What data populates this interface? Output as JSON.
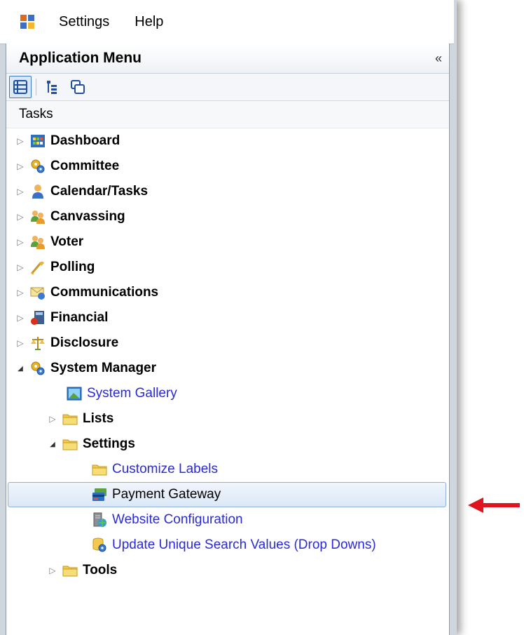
{
  "menubar": {
    "items": [
      "Settings",
      "Help"
    ]
  },
  "panel": {
    "title": "Application Menu",
    "collapse_glyph": "«",
    "section_label": "Tasks"
  },
  "tree": {
    "dashboard": "Dashboard",
    "committee": "Committee",
    "calendar": "Calendar/Tasks",
    "canvassing": "Canvassing",
    "voter": "Voter",
    "polling": "Polling",
    "communications": "Communications",
    "financial": "Financial",
    "disclosure": "Disclosure",
    "system_manager": "System Manager",
    "system_gallery": "System Gallery",
    "lists": "Lists",
    "settings": "Settings",
    "customize_labels": "Customize Labels",
    "payment_gateway": "Payment Gateway",
    "website_configuration": "Website Configuration",
    "update_unique": "Update Unique Search Values (Drop Downs)",
    "tools": "Tools"
  },
  "icons": {
    "collapsed": "▷",
    "expanded": "◢"
  },
  "colors": {
    "link": "#2a2ad6",
    "selection_border": "#8fb0d9",
    "arrow": "#e0141e"
  }
}
